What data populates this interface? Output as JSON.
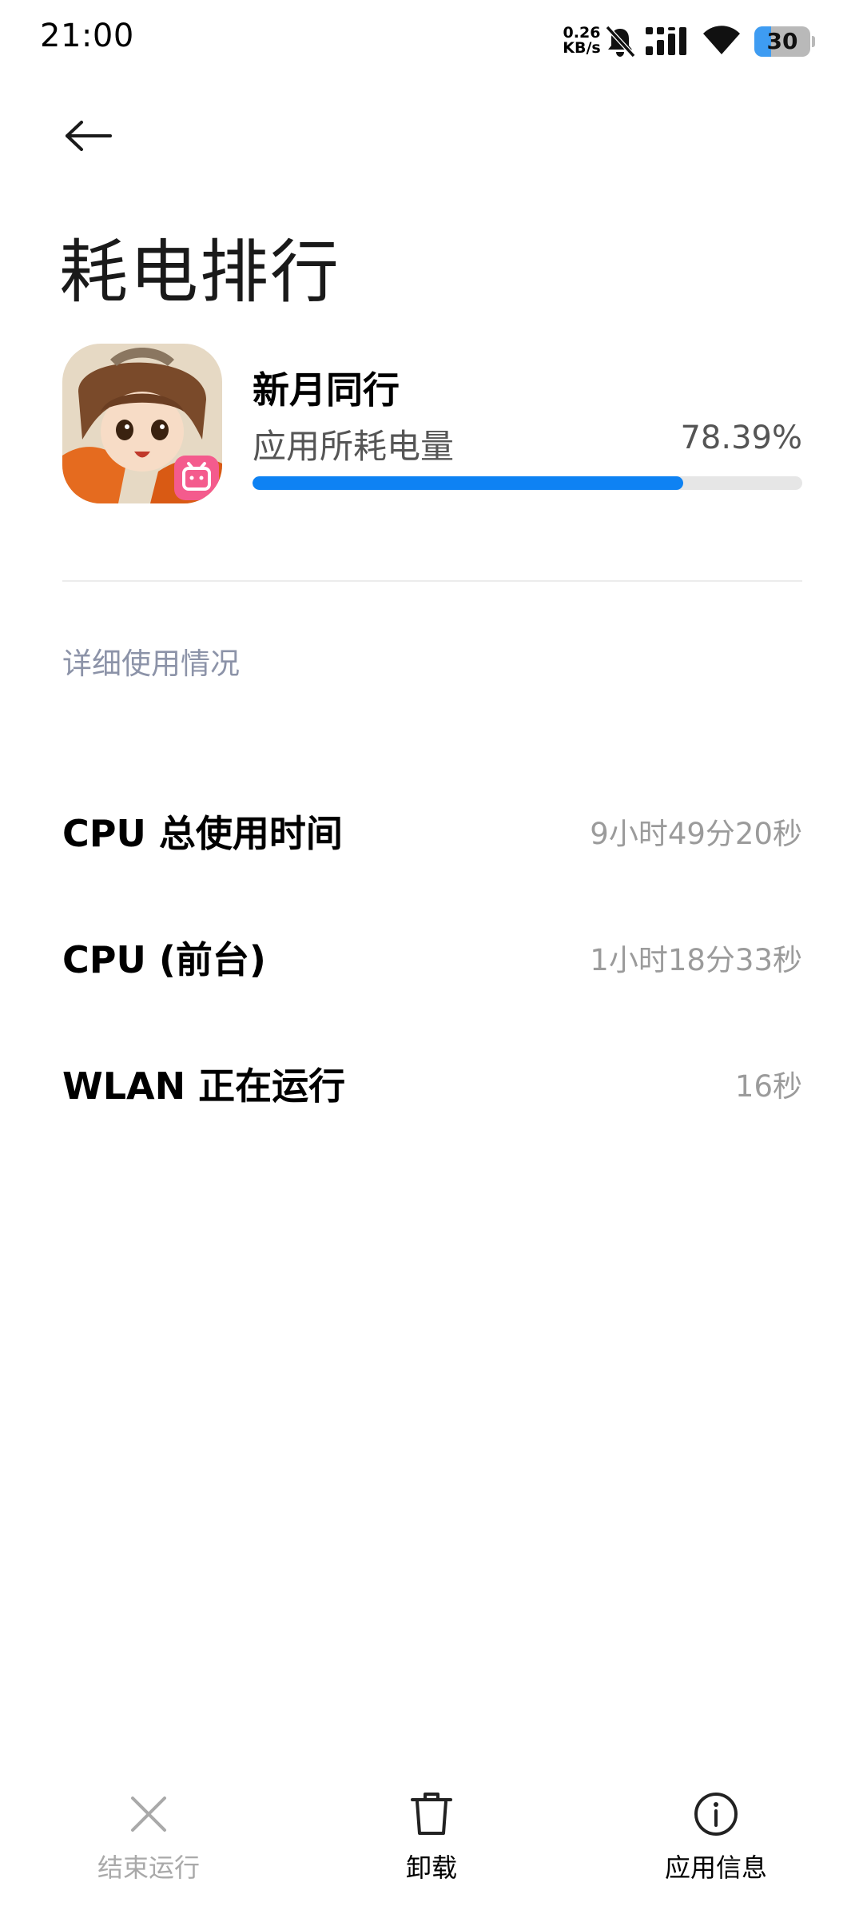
{
  "status_bar": {
    "time": "21:00",
    "net_speed_value": "0.26",
    "net_speed_unit": "KB/s",
    "battery_level": "30",
    "battery_fraction": 0.3,
    "icons": [
      "bell-off-icon",
      "signal-icon",
      "wifi-icon",
      "battery-icon"
    ]
  },
  "header": {
    "back_icon": "back-arrow-icon",
    "title": "耗电排行"
  },
  "app": {
    "name": "新月同行",
    "usage_label": "应用所耗电量",
    "usage_percent_text": "78.39%",
    "usage_fraction": 0.7839
  },
  "details": {
    "section_title": "详细使用情况",
    "rows": [
      {
        "label": "CPU 总使用时间",
        "value": "9小时49分20秒"
      },
      {
        "label": "CPU (前台)",
        "value": "1小时18分33秒"
      },
      {
        "label": "WLAN 正在运行",
        "value": "16秒"
      }
    ]
  },
  "bottom_bar": {
    "end_label": "结束运行",
    "end_enabled": false,
    "uninstall_label": "卸载",
    "info_label": "应用信息"
  },
  "colors": {
    "accent": "#0e82f3",
    "track": "#e6e6e6",
    "section_header": "#8c93a8",
    "secondary_text": "#9b9b9b",
    "disabled": "#a9a9a9",
    "battery": "#3e9cf2"
  }
}
